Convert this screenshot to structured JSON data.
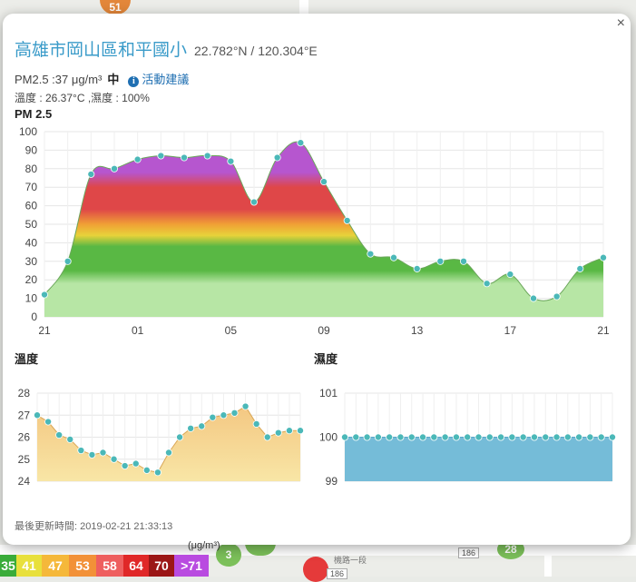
{
  "map": {
    "markers": [
      {
        "label": "51",
        "color": "#e3873a"
      },
      {
        "label": "3",
        "color": "#7cc05a"
      },
      {
        "label": "28",
        "color": "#7cc05a"
      },
      {
        "label": "",
        "color": "#7cc05a"
      },
      {
        "label": "",
        "color": "#e53a3a"
      }
    ],
    "road_labels": [
      "186",
      "186"
    ],
    "street_label": "機路一段"
  },
  "popup": {
    "close": "×",
    "title": "高雄市岡山區和平國小",
    "coords": "22.782°N / 120.304°E",
    "pm25_reading": "PM2.5 :37 μg/m³",
    "pm25_level": "中",
    "advice_icon": "i",
    "advice_link": "活動建議",
    "weather": "溫度 : 26.37°C ,濕度 : 100%",
    "updated": "最後更新時間: 2019-02-21 21:33:13"
  },
  "legend": {
    "unit": "(μg/m³)",
    "items": [
      {
        "label": "35",
        "color": "#3aac3a"
      },
      {
        "label": "41",
        "color": "#e8e03c"
      },
      {
        "label": "47",
        "color": "#f5b83a"
      },
      {
        "label": "53",
        "color": "#f29138"
      },
      {
        "label": "58",
        "color": "#ee5f5f"
      },
      {
        "label": "64",
        "color": "#e02828"
      },
      {
        "label": "70",
        "color": "#9b1616"
      },
      {
        "label": ">71",
        "color": "#b94be0"
      }
    ]
  },
  "chart_data": [
    {
      "type": "area",
      "title": "PM 2.5",
      "x_tick_labels": [
        "21",
        "01",
        "05",
        "09",
        "13",
        "17",
        "21"
      ],
      "ylim": [
        0,
        100
      ],
      "y_ticks": [
        0,
        10,
        20,
        30,
        40,
        50,
        60,
        70,
        80,
        90,
        100
      ],
      "grid": true,
      "values": [
        12,
        30,
        77,
        80,
        85,
        87,
        86,
        87,
        84,
        62,
        86,
        94,
        73,
        52,
        34,
        32,
        26,
        30,
        30,
        18,
        23,
        10,
        11,
        26,
        32
      ],
      "colors": {
        "green": "#59b844",
        "yellow": "#e8d23a",
        "orange": "#f0a035",
        "red": "#df4748",
        "purple": "#b656cf",
        "light_green": "#b7e6a5",
        "marker": "#4bb8b8"
      }
    },
    {
      "type": "area",
      "title": "溫度",
      "ylim": [
        24,
        28
      ],
      "y_ticks": [
        24,
        25,
        26,
        27,
        28
      ],
      "grid": true,
      "values": [
        27.0,
        26.7,
        26.1,
        25.9,
        25.4,
        25.2,
        25.3,
        25.0,
        24.7,
        24.8,
        24.5,
        24.4,
        25.3,
        26.0,
        26.4,
        26.5,
        26.9,
        27.0,
        27.1,
        27.4,
        26.6,
        26.0,
        26.2,
        26.3,
        26.3
      ],
      "colors": {
        "fill_top": "#f3c27c",
        "fill_bottom": "#f8e6a6",
        "marker": "#4bb8b8"
      }
    },
    {
      "type": "area",
      "title": "濕度",
      "ylim": [
        99,
        101
      ],
      "y_ticks": [
        99,
        100,
        101
      ],
      "grid": true,
      "values": [
        100,
        100,
        100,
        100,
        100,
        100,
        100,
        100,
        100,
        100,
        100,
        100,
        100,
        100,
        100,
        100,
        100,
        100,
        100,
        100,
        100,
        100,
        100,
        100,
        100
      ],
      "colors": {
        "fill": "#75bcd8",
        "marker": "#4bb8b8"
      }
    }
  ]
}
